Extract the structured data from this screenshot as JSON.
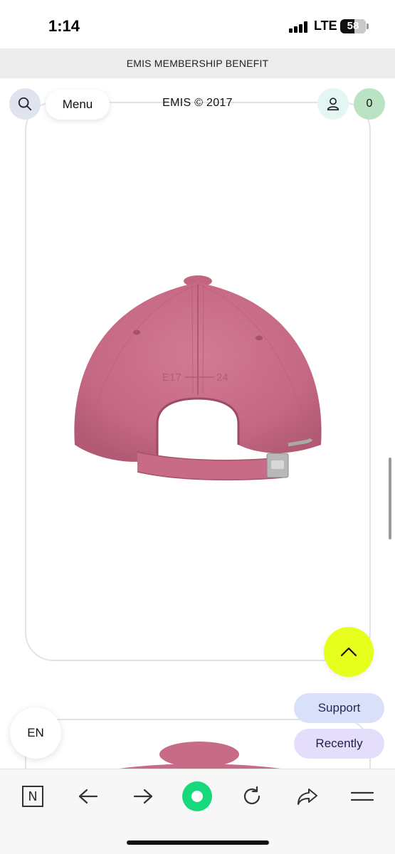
{
  "status_bar": {
    "time": "1:14",
    "network": "LTE",
    "battery": "58"
  },
  "banner": {
    "text": "EMIS MEMBERSHIP BENEFIT"
  },
  "header": {
    "menu_label": "Menu",
    "brand": "EMIS © 2017",
    "cart_count": "0"
  },
  "product": {
    "image_icon": "pink-baseball-cap-back-view",
    "embroidery_left": "E17",
    "embroidery_right": "24",
    "color": "#c86b86"
  },
  "floating": {
    "support_label": "Support",
    "recently_label": "Recently",
    "language_label": "EN"
  },
  "bottom_nav": {
    "n_label": "N",
    "items": [
      "n-icon",
      "back-arrow-icon",
      "forward-arrow-icon",
      "home-dot-icon",
      "refresh-icon",
      "share-icon",
      "menu-icon"
    ]
  },
  "colors": {
    "accent_lime": "#e6ff1c",
    "home_green": "#15d97a",
    "support_bg": "#d8e0fa",
    "recently_bg": "#e4defa"
  }
}
